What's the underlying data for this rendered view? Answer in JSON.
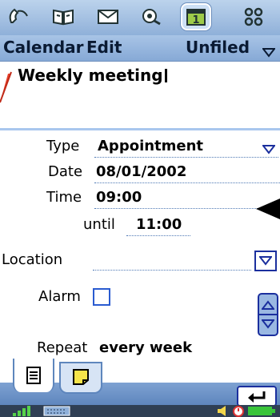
{
  "toolbar": {
    "icons": [
      "phone-icon",
      "contacts-icon",
      "messages-icon",
      "web-icon",
      "calendar-icon",
      "apps-icon"
    ],
    "calendar_day": "1"
  },
  "menubar": {
    "calendar": "Calendar",
    "edit": "Edit",
    "folder": "Unfiled"
  },
  "entry": {
    "title": "Weekly meeting",
    "type_label": "Type",
    "type_value": "Appointment",
    "date_label": "Date",
    "date_value": "08/01/2002",
    "time_label": "Time",
    "time_value": "09:00",
    "until_label": "until",
    "until_value": "11:00",
    "location_label": "Location",
    "location_value": "",
    "alarm_label": "Alarm",
    "alarm_checked": false,
    "repeat_label": "Repeat",
    "repeat_value": "every week"
  },
  "colors": {
    "accent": "#6d8fbd",
    "dropdown_arrow": "#1b2f9e",
    "field_line": "#4f79b5"
  }
}
